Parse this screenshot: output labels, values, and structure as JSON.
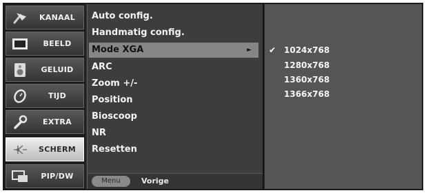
{
  "categories": [
    {
      "label": "KANAAL",
      "icon": "antenna-icon"
    },
    {
      "label": "BEELD",
      "icon": "picture-icon"
    },
    {
      "label": "GELUID",
      "icon": "speaker-icon"
    },
    {
      "label": "TIJD",
      "icon": "clock-icon"
    },
    {
      "label": "EXTRA",
      "icon": "wrench-icon"
    },
    {
      "label": "SCHERM",
      "icon": "screen-icon"
    },
    {
      "label": "PIP/DW",
      "icon": "pip-icon"
    }
  ],
  "active_category": "SCHERM",
  "submenu": {
    "items": [
      "Auto config.",
      "Handmatig config.",
      "Mode XGA",
      "ARC",
      "Zoom +/-",
      "Position",
      "Bioscoop",
      "NR",
      "Resetten"
    ],
    "selected": "Mode XGA",
    "arrow": "►"
  },
  "footer": {
    "menu_button": "Menu",
    "label": "Vorige"
  },
  "options": {
    "items": [
      "1024x768",
      "1280x768",
      "1360x768",
      "1366x768"
    ],
    "checked": "1024x768",
    "check_mark": "✔"
  }
}
